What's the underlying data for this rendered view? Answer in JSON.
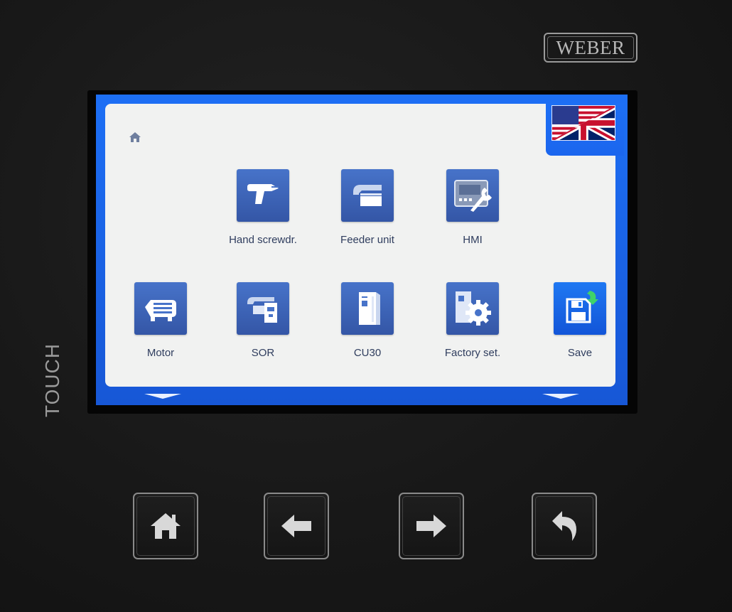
{
  "brand": "WEBER",
  "side_label": "TOUCH",
  "screen": {
    "language_flag": "uk-us-flag-icon",
    "breadcrumb_icon": "home-icon",
    "apps": [
      {
        "label": "Hand screwdr.",
        "icon": "hand-screwdriver-icon"
      },
      {
        "label": "Feeder unit",
        "icon": "feeder-unit-icon"
      },
      {
        "label": "HMI",
        "icon": "hmi-wrench-icon"
      },
      {
        "label": "Motor",
        "icon": "motor-icon"
      },
      {
        "label": "SOR",
        "icon": "sor-icon"
      },
      {
        "label": "CU30",
        "icon": "cu30-icon"
      },
      {
        "label": "Factory set.",
        "icon": "factory-settings-gear-icon"
      },
      {
        "label": "Save",
        "icon": "save-floppy-icon"
      }
    ],
    "scroll_indicators": [
      "scroll-down-left-icon",
      "scroll-down-right-icon"
    ]
  },
  "hardware_buttons": [
    {
      "name": "home",
      "icon": "home-icon"
    },
    {
      "name": "left",
      "icon": "arrow-left-icon"
    },
    {
      "name": "right",
      "icon": "arrow-right-icon"
    },
    {
      "name": "back",
      "icon": "undo-back-icon"
    }
  ],
  "colors": {
    "screen_blue": "#1d6ff5",
    "tile_blue": "#4773c9",
    "save_blue": "#1f78f2",
    "panel": "#f1f2f1",
    "bezel": "#141414"
  }
}
